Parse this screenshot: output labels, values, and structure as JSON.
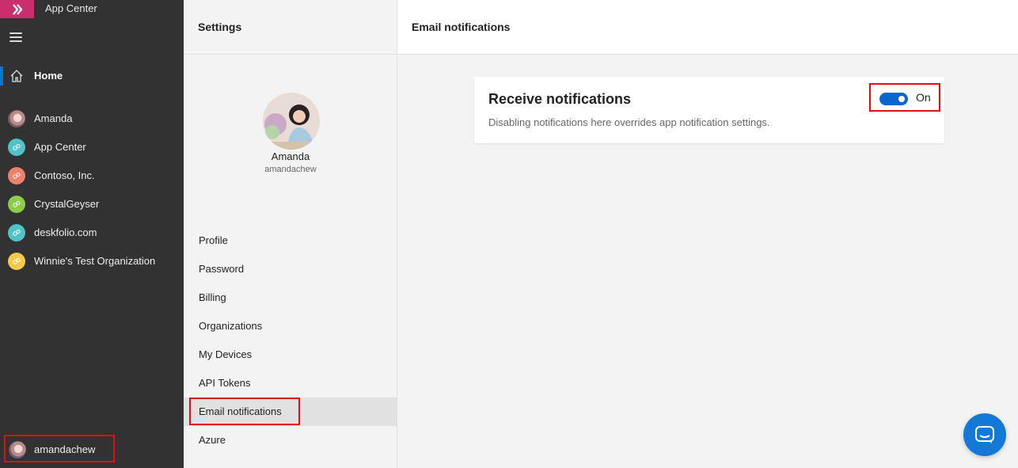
{
  "nav": {
    "app_title": "App Center",
    "home_label": "Home",
    "orgs": [
      {
        "label": "Amanda",
        "color": "avatar"
      },
      {
        "label": "App Center",
        "color": "#4fc3c7"
      },
      {
        "label": "Contoso, Inc.",
        "color": "#f0826b"
      },
      {
        "label": "CrystalGeyser",
        "color": "#8dcc4b"
      },
      {
        "label": "deskfolio.com",
        "color": "#4fc3c7"
      },
      {
        "label": "Winnie's Test Organization",
        "color": "#f6c94a"
      }
    ],
    "current_user": "amandachew"
  },
  "settings": {
    "title": "Settings",
    "profile_name": "Amanda",
    "profile_handle": "amandachew",
    "menu": [
      "Profile",
      "Password",
      "Billing",
      "Organizations",
      "My Devices",
      "API Tokens",
      "Email notifications",
      "Azure"
    ],
    "active_item": "Email notifications"
  },
  "main": {
    "title": "Email notifications",
    "card": {
      "title": "Receive notifications",
      "description": "Disabling notifications here overrides app notification settings.",
      "toggle_label": "On"
    }
  },
  "colors": {
    "nav_bg": "#323232",
    "logo_bg": "#cb2e6d",
    "accent": "#0078d4",
    "toggle_on": "#0a66cc",
    "highlight_border": "#dd1111"
  }
}
